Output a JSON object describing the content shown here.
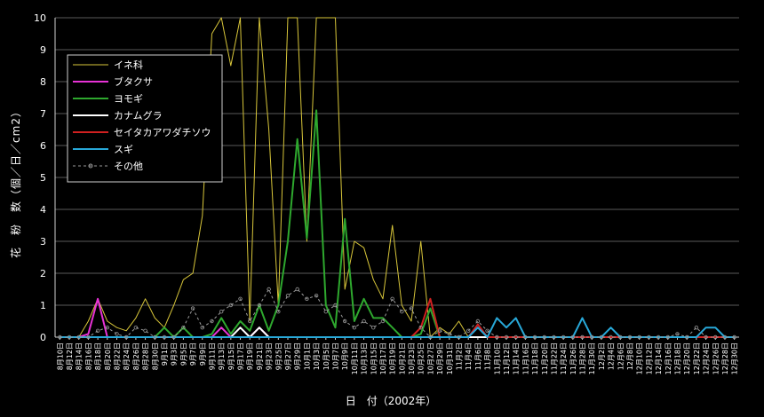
{
  "chart_data": {
    "type": "line",
    "title": "",
    "xlabel": "日　付（2002年）",
    "ylabel": "花　粉　数（個／日／cm2）",
    "ylim": [
      0,
      10
    ],
    "yticks": [
      0,
      1,
      2,
      3,
      4,
      5,
      6,
      7,
      8,
      9,
      10
    ],
    "grid": true,
    "legend_position": "top-left",
    "colors": {
      "background": "#000000",
      "grid": "#5a5a5a",
      "axis": "#cfcfcf",
      "text": "#ffffff"
    },
    "x": [
      "8月10日",
      "8月12日",
      "8月14日",
      "8月16日",
      "8月18日",
      "8月20日",
      "8月22日",
      "8月24日",
      "8月26日",
      "8月28日",
      "8月30日",
      "9月1日",
      "9月3日",
      "9月5日",
      "9月7日",
      "9月9日",
      "9月11日",
      "9月13日",
      "9月15日",
      "9月17日",
      "9月19日",
      "9月21日",
      "9月23日",
      "9月25日",
      "9月27日",
      "9月29日",
      "10月1日",
      "10月3日",
      "10月5日",
      "10月7日",
      "10月9日",
      "10月11日",
      "10月13日",
      "10月15日",
      "10月17日",
      "10月19日",
      "10月21日",
      "10月23日",
      "10月25日",
      "10月27日",
      "10月29日",
      "10月31日",
      "11月2日",
      "11月4日",
      "11月6日",
      "11月8日",
      "11月10日",
      "11月12日",
      "11月14日",
      "11月16日",
      "11月18日",
      "11月20日",
      "11月22日",
      "11月24日",
      "11月26日",
      "11月28日",
      "11月30日",
      "12月2日",
      "12月4日",
      "12月6日",
      "12月8日",
      "12月10日",
      "12月12日",
      "12月14日",
      "12月16日",
      "12月18日",
      "12月20日",
      "12月22日",
      "12月24日",
      "12月26日",
      "12月28日",
      "12月30日"
    ],
    "series": [
      {
        "name": "イネ科",
        "color": "#d8c63a",
        "width": 1,
        "dash": "",
        "values": [
          0,
          0,
          0,
          0.5,
          1.2,
          0.5,
          0.3,
          0.2,
          0.6,
          1.2,
          0.6,
          0.3,
          1.0,
          1.8,
          2.0,
          3.8,
          9.5,
          10,
          8.5,
          10,
          0.5,
          10,
          6.5,
          1.0,
          10,
          10,
          3.0,
          10,
          10,
          10,
          1.5,
          3.0,
          2.8,
          1.8,
          1.2,
          3.5,
          1.0,
          0.5,
          3.0,
          0,
          0.3,
          0.1,
          0.5,
          0,
          0,
          0,
          0,
          0,
          0,
          0,
          0,
          0,
          0,
          0,
          0,
          0,
          0,
          0,
          0,
          0,
          0,
          0,
          0,
          0,
          0,
          0,
          0,
          0,
          0,
          0,
          0,
          0
        ]
      },
      {
        "name": "ブタクサ",
        "color": "#e832d6",
        "width": 2,
        "dash": "",
        "values": [
          0,
          0,
          0,
          0.1,
          1.2,
          0,
          0,
          0,
          0,
          0,
          0,
          0,
          0,
          0,
          0,
          0,
          0,
          0.3,
          0,
          0,
          0,
          0.3,
          0,
          0,
          0,
          0,
          0,
          0,
          0,
          0,
          0,
          0,
          0,
          0,
          0,
          0,
          0,
          0,
          0,
          0,
          0,
          0,
          0,
          0,
          0,
          0,
          0,
          0,
          0,
          0,
          0,
          0,
          0,
          0,
          0,
          0,
          0,
          0,
          0,
          0,
          0,
          0,
          0,
          0,
          0,
          0,
          0,
          0,
          0,
          0,
          0,
          0
        ]
      },
      {
        "name": "ヨモギ",
        "color": "#2ea82e",
        "width": 2,
        "dash": "",
        "values": [
          0,
          0,
          0,
          0,
          0,
          0,
          0,
          0,
          0,
          0,
          0,
          0.3,
          0,
          0.3,
          0,
          0,
          0.1,
          0.6,
          0.1,
          0.5,
          0.2,
          1.0,
          0.2,
          1.0,
          3.0,
          6.2,
          3.1,
          7.1,
          1.0,
          0.3,
          3.7,
          0.5,
          1.2,
          0.6,
          0.6,
          0.3,
          0,
          0,
          0.1,
          0.9,
          0,
          0,
          0,
          0,
          0,
          0,
          0,
          0,
          0,
          0,
          0,
          0,
          0,
          0,
          0,
          0,
          0,
          0,
          0,
          0,
          0,
          0,
          0,
          0,
          0,
          0,
          0,
          0,
          0,
          0,
          0,
          0
        ]
      },
      {
        "name": "カナムグラ",
        "color": "#ffffff",
        "width": 2,
        "dash": "",
        "values": [
          0,
          0,
          0,
          0,
          0,
          0,
          0,
          0,
          0,
          0,
          0,
          0,
          0,
          0,
          0,
          0,
          0,
          0,
          0,
          0.3,
          0,
          0.3,
          0,
          0,
          0,
          0,
          0,
          0,
          0,
          0,
          0,
          0,
          0,
          0,
          0,
          0,
          0,
          0,
          0,
          0,
          0,
          0,
          0,
          0,
          0,
          0,
          0,
          0,
          0,
          0,
          0,
          0,
          0,
          0,
          0,
          0,
          0,
          0,
          0,
          0,
          0,
          0,
          0,
          0,
          0,
          0,
          0,
          0,
          0,
          0,
          0,
          0
        ]
      },
      {
        "name": "セイタカアワダチソウ",
        "color": "#d02020",
        "width": 2,
        "dash": "",
        "values": [
          0,
          0,
          0,
          0,
          0,
          0,
          0,
          0,
          0,
          0,
          0,
          0,
          0,
          0,
          0,
          0,
          0,
          0,
          0,
          0,
          0,
          0,
          0,
          0,
          0,
          0,
          0,
          0,
          0,
          0,
          0,
          0,
          0,
          0,
          0,
          0,
          0,
          0,
          0.3,
          1.2,
          0,
          0,
          0,
          0,
          0.4,
          0,
          0,
          0,
          0,
          0,
          0,
          0,
          0,
          0,
          0,
          0,
          0,
          0,
          0,
          0,
          0,
          0,
          0,
          0,
          0,
          0,
          0,
          0,
          0,
          0,
          0,
          0
        ]
      },
      {
        "name": "スギ",
        "color": "#28a8d8",
        "width": 2,
        "dash": "",
        "values": [
          0,
          0,
          0,
          0,
          0,
          0,
          0,
          0,
          0,
          0,
          0,
          0,
          0,
          0,
          0,
          0,
          0,
          0,
          0,
          0,
          0,
          0,
          0,
          0,
          0,
          0,
          0,
          0,
          0,
          0,
          0,
          0,
          0,
          0,
          0,
          0,
          0,
          0,
          0,
          0,
          0,
          0,
          0,
          0,
          0.3,
          0,
          0.6,
          0.3,
          0.6,
          0,
          0,
          0,
          0,
          0,
          0,
          0.6,
          0,
          0,
          0.3,
          0,
          0,
          0,
          0,
          0,
          0,
          0,
          0,
          0,
          0.3,
          0.3,
          0,
          0
        ]
      },
      {
        "name": "その他",
        "color": "#9a9a9a",
        "width": 1,
        "dash": "3,3",
        "markers": true,
        "values": [
          0,
          0,
          0,
          0,
          0.2,
          0.3,
          0.1,
          0,
          0.3,
          0.2,
          0,
          0,
          0,
          0.3,
          0.9,
          0.3,
          0.5,
          0.8,
          1.0,
          1.2,
          0.5,
          1.0,
          1.5,
          0.8,
          1.3,
          1.5,
          1.2,
          1.3,
          0.8,
          1.0,
          0.5,
          0.3,
          0.5,
          0.3,
          0.5,
          1.2,
          0.8,
          0.9,
          0.3,
          0,
          0.2,
          0.1,
          0,
          0.2,
          0.5,
          0.2,
          0,
          0,
          0,
          0,
          0,
          0,
          0,
          0,
          0,
          0,
          0,
          0,
          0,
          0,
          0,
          0,
          0,
          0,
          0,
          0.1,
          0,
          0.3,
          0,
          0,
          0,
          0
        ]
      }
    ]
  }
}
